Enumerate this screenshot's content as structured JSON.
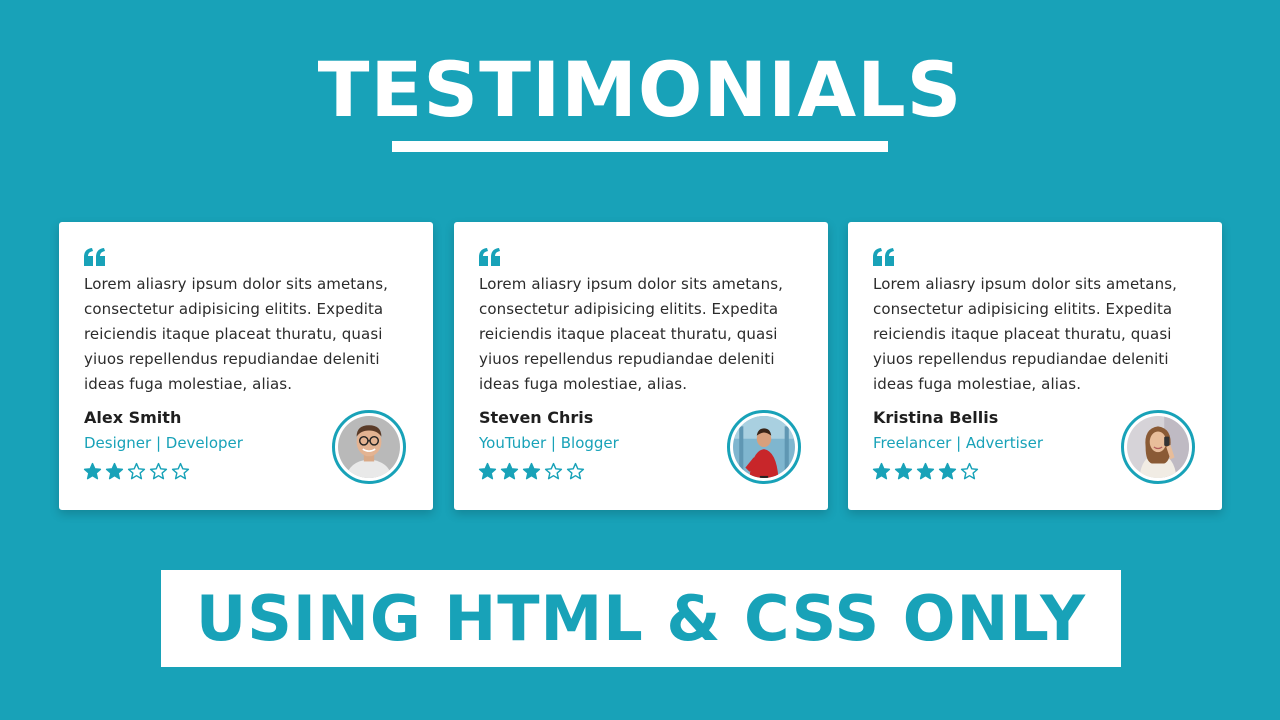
{
  "heading": {
    "title": "TESTIMONIALS"
  },
  "testimonials": [
    {
      "text": "Lorem aliasry ipsum dolor sits ametans, consectetur adipisicing elitits. Expedita reiciendis itaque placeat thuratu, quasi yiuos repellendus repudiandae deleniti ideas fuga molestiae, alias.",
      "name": "Alex Smith",
      "role": "Designer | Developer",
      "rating": 2,
      "max_rating": 5,
      "avatar": "man-with-glasses-portrait"
    },
    {
      "text": "Lorem aliasry ipsum dolor sits ametans, consectetur adipisicing elitits. Expedita reiciendis itaque placeat thuratu, quasi yiuos repellendus repudiandae deleniti ideas fuga molestiae, alias.",
      "name": "Steven Chris",
      "role": "YouTuber | Blogger",
      "rating": 3,
      "max_rating": 5,
      "avatar": "man-in-red-shirt-portrait"
    },
    {
      "text": "Lorem aliasry ipsum dolor sits ametans, consectetur adipisicing elitits. Expedita reiciendis itaque placeat thuratu, quasi yiuos repellendus repudiandae deleniti ideas fuga molestiae, alias.",
      "name": "Kristina Bellis",
      "role": "Freelancer | Advertiser",
      "rating": 4,
      "max_rating": 5,
      "avatar": "woman-with-phone-portrait"
    }
  ],
  "banner": {
    "text": "USING HTML & CSS ONLY"
  },
  "colors": {
    "accent": "#18a2b8",
    "card": "#ffffff",
    "text": "#2b2b2b"
  }
}
